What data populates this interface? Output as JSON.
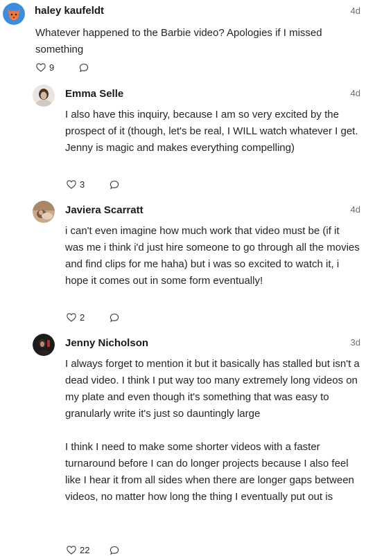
{
  "comments": [
    {
      "author": "haley kaufeldt",
      "time": "4d",
      "avatar_icon": "fox-avatar-icon",
      "body": [
        "Whatever happened to the Barbie video? Apologies if I missed something"
      ],
      "likes": "9"
    },
    {
      "author": "Emma Selle",
      "time": "4d",
      "avatar_icon": "photo-avatar",
      "body": [
        "I also have this inquiry, because I am so very excited by the prospect of it (though, let's be real, I WILL watch whatever I get. Jenny is magic and makes everything compelling)"
      ],
      "likes": "3"
    },
    {
      "author": "Javiera Scarratt",
      "time": "4d",
      "avatar_icon": "photo-avatar",
      "body": [
        "i can't even imagine how much work that video must be (if it was me i think i'd just hire someone to go through all the movies and find clips for me haha) but i was so excited to watch it, i hope it comes out in some form eventually!"
      ],
      "likes": "2"
    },
    {
      "author": "Jenny Nicholson",
      "time": "3d",
      "avatar_icon": "photo-avatar",
      "body": [
        "I always forget to mention it but it basically has stalled but isn't a dead video. I think I put way too many extremely long videos on my plate and even though it's something that was easy to granularly write it's just so dauntingly large",
        "I think I need to make some shorter videos with a faster turnaround before I can do longer projects because I also feel like I hear it from all sides when there are longer gaps between videos, no matter how long the thing I eventually put out is"
      ],
      "likes": "22"
    }
  ],
  "colors": {
    "fox_orange": "#f0743c",
    "avatar_bg_blue": "#3b8de0"
  }
}
